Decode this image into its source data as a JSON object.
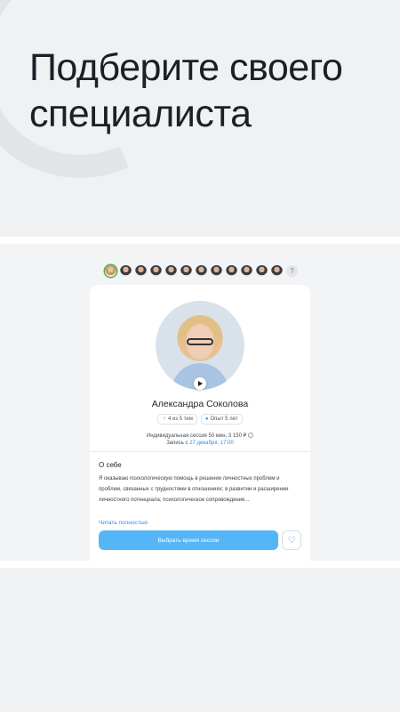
{
  "headline": "Подберите своего специалиста",
  "specialist_strip": {
    "count_avatars": 12,
    "more_label": "?"
  },
  "specialist": {
    "name": "Александра Соколова",
    "badge_topics": "4 из 5 тем",
    "badge_experience": "Опыт 5 лет",
    "session_info": "Индивидуальная сессия 50 мин, 3 150 ₽",
    "record_prefix": "Запись с",
    "record_date": "27 декабря, 17:00"
  },
  "about": {
    "title": "О себе",
    "text": "Я оказываю психологическую помощь в решении личностных проблем и проблем, связанных с трудностями в отношениях; в развитии и расширении личностного потенциала; психологическое сопровождение...",
    "read_more": "Читать полностью"
  },
  "actions": {
    "choose_time": "Выбрать время сессии"
  },
  "colors": {
    "accent": "#54b6f7",
    "link": "#2f8ee6",
    "background": "#f0f1f3"
  }
}
